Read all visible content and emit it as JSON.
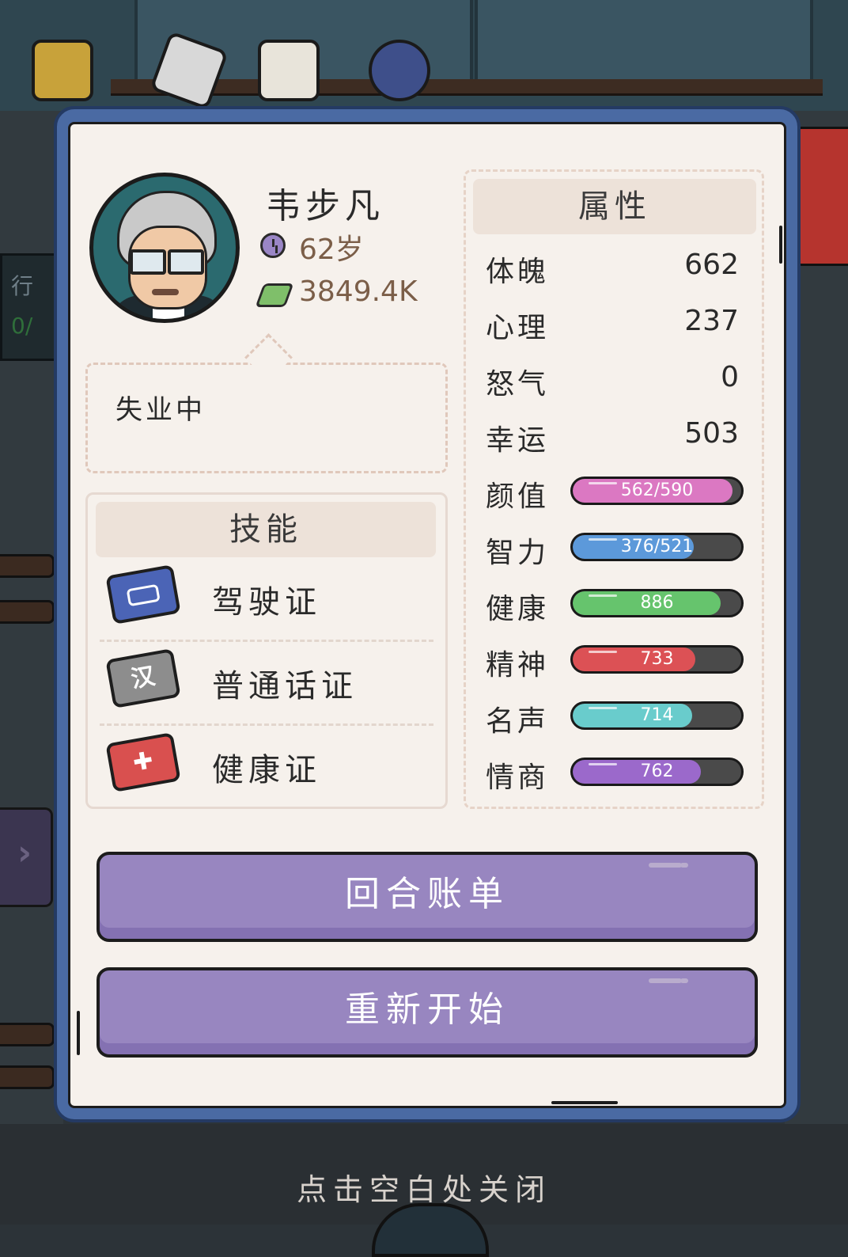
{
  "character": {
    "name": "韦步凡",
    "age": "62岁",
    "money": "3849.4K",
    "status": "失业中"
  },
  "skills": {
    "title": "技能",
    "items": [
      {
        "label": "驾驶证",
        "icon": "car-license-icon",
        "icon_text": "",
        "color": "#4b64b6"
      },
      {
        "label": "普通话证",
        "icon": "mandarin-license-icon",
        "icon_text": "汉",
        "color": "#8d8d8d"
      },
      {
        "label": "健康证",
        "icon": "health-license-icon",
        "icon_text": "✚",
        "color": "#d9504f"
      }
    ]
  },
  "attributes": {
    "title": "属性",
    "stats": [
      {
        "label": "体魄",
        "value": "662"
      },
      {
        "label": "心理",
        "value": "237"
      },
      {
        "label": "怒气",
        "value": "0"
      },
      {
        "label": "幸运",
        "value": "503"
      }
    ],
    "bars": [
      {
        "label": "颜值",
        "text": "562/590",
        "fill": 0.95,
        "color": "#db78c2"
      },
      {
        "label": "智力",
        "text": "376/521",
        "fill": 0.72,
        "color": "#5c99da"
      },
      {
        "label": "健康",
        "text": "886",
        "fill": 0.88,
        "color": "#66c46d"
      },
      {
        "label": "精神",
        "text": "733",
        "fill": 0.73,
        "color": "#dc5155"
      },
      {
        "label": "名声",
        "text": "714",
        "fill": 0.71,
        "color": "#69cccc"
      },
      {
        "label": "情商",
        "text": "762",
        "fill": 0.76,
        "color": "#9b69cb"
      }
    ]
  },
  "buttons": {
    "round_bill": "回合账单",
    "restart": "重新开始"
  },
  "close_hint": "点击空白处关闭",
  "background": {
    "side_label": "行",
    "side_count": "0/"
  }
}
